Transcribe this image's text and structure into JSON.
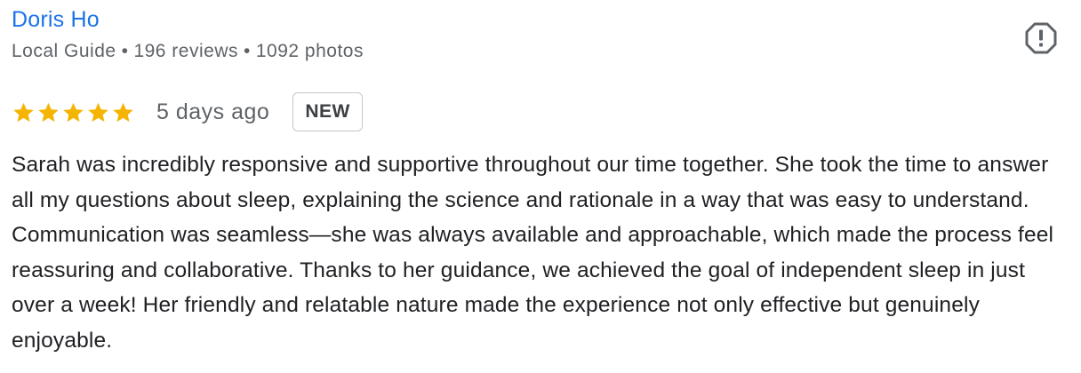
{
  "reviewer": {
    "name": "Doris Ho",
    "badge": "Local Guide",
    "review_count": "196 reviews",
    "photo_count": "1092 photos",
    "separator": "•"
  },
  "rating": {
    "value": 5,
    "max": 5,
    "star_color": "#f4b400",
    "icon": "star-icon"
  },
  "time_ago": "5 days ago",
  "new_badge": "NEW",
  "report_icon": "report-flag-icon",
  "review_text": "Sarah was incredibly responsive and supportive throughout our time together. She took the time to answer all my questions about sleep, explaining the science and rationale in a way that was easy to understand. Communication was seamless—she was always available and approachable, which made the process feel reassuring and collaborative. Thanks to her guidance, we achieved the goal of independent sleep in just over a week! Her friendly and relatable nature made the experience not only effective but genuinely enjoyable.",
  "colors": {
    "name_link": "#1a73e8",
    "meta_text": "#5f6368",
    "body_text": "#202124"
  }
}
